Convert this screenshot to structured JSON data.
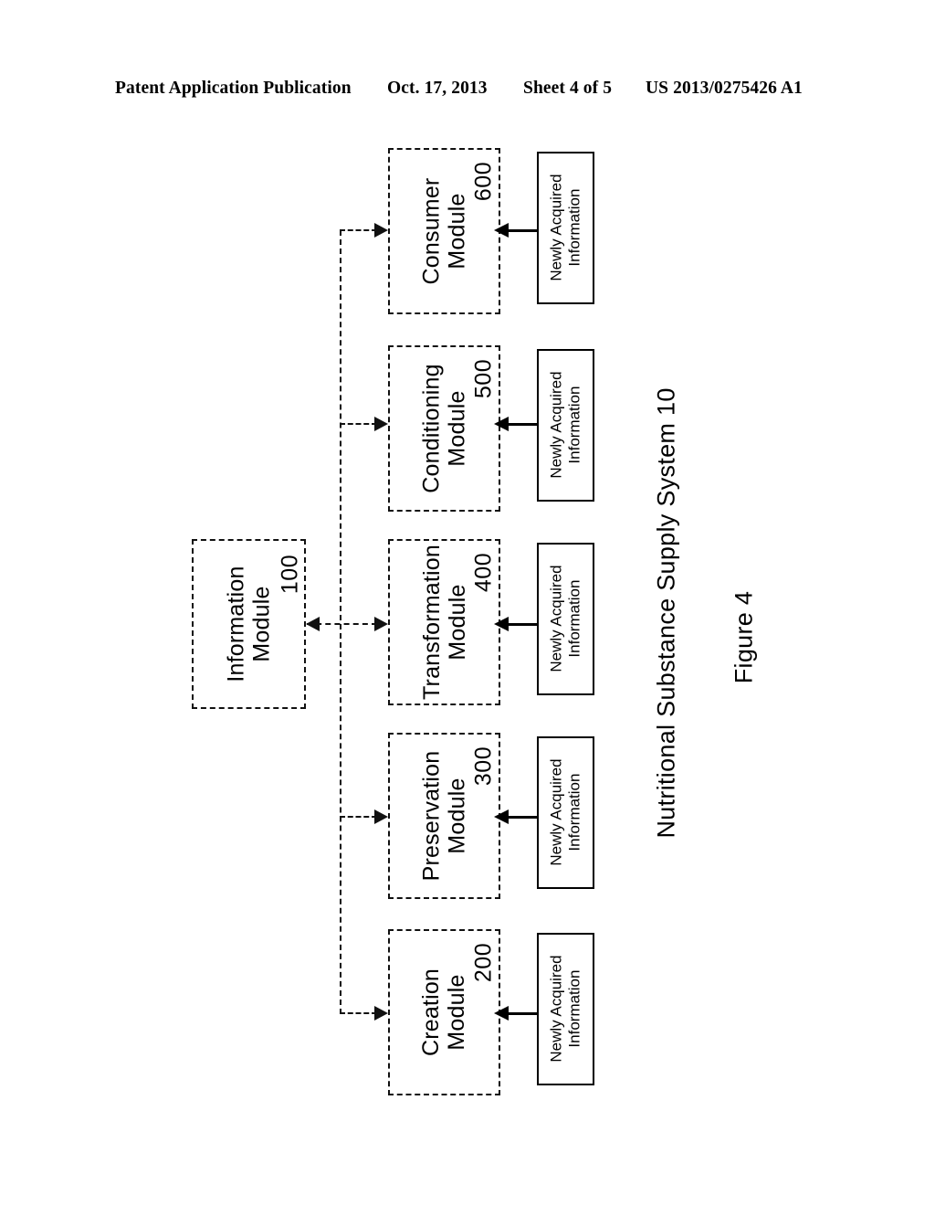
{
  "header": {
    "publication": "Patent Application Publication",
    "date": "Oct. 17, 2013",
    "sheet": "Sheet 4 of 5",
    "patent_number": "US 2013/0275426 A1"
  },
  "figure": {
    "caption": "Figure 4",
    "system_label": "Nutritional Substance Supply System  10",
    "orientation": "landscape-rotated-90ccw",
    "line_color": "#111111",
    "box_fill": "#ffffff"
  },
  "information_module": {
    "title_line1": "Information",
    "title_line2": "Module",
    "ref": "100",
    "border_style": "dashed"
  },
  "modules": [
    {
      "title_line1": "Consumer",
      "title_line2": "Module",
      "ref": "600",
      "border_style": "dashed",
      "input_box": {
        "line1": "Newly Acquired",
        "line2": "Information",
        "border_style": "solid"
      }
    },
    {
      "title_line1": "Conditioning",
      "title_line2": "Module",
      "ref": "500",
      "border_style": "dashed",
      "input_box": {
        "line1": "Newly Acquired",
        "line2": "Information",
        "border_style": "solid"
      }
    },
    {
      "title_line1": "Transformation",
      "title_line2": "Module",
      "ref": "400",
      "border_style": "dashed",
      "input_box": {
        "line1": "Newly Acquired",
        "line2": "Information",
        "border_style": "solid"
      }
    },
    {
      "title_line1": "Preservation",
      "title_line2": "Module",
      "ref": "300",
      "border_style": "dashed",
      "input_box": {
        "line1": "Newly Acquired",
        "line2": "Information",
        "border_style": "solid"
      }
    },
    {
      "title_line1": "Creation",
      "title_line2": "Module",
      "ref": "200",
      "border_style": "dashed",
      "input_box": {
        "line1": "Newly Acquired",
        "line2": "Information",
        "border_style": "solid"
      }
    }
  ]
}
